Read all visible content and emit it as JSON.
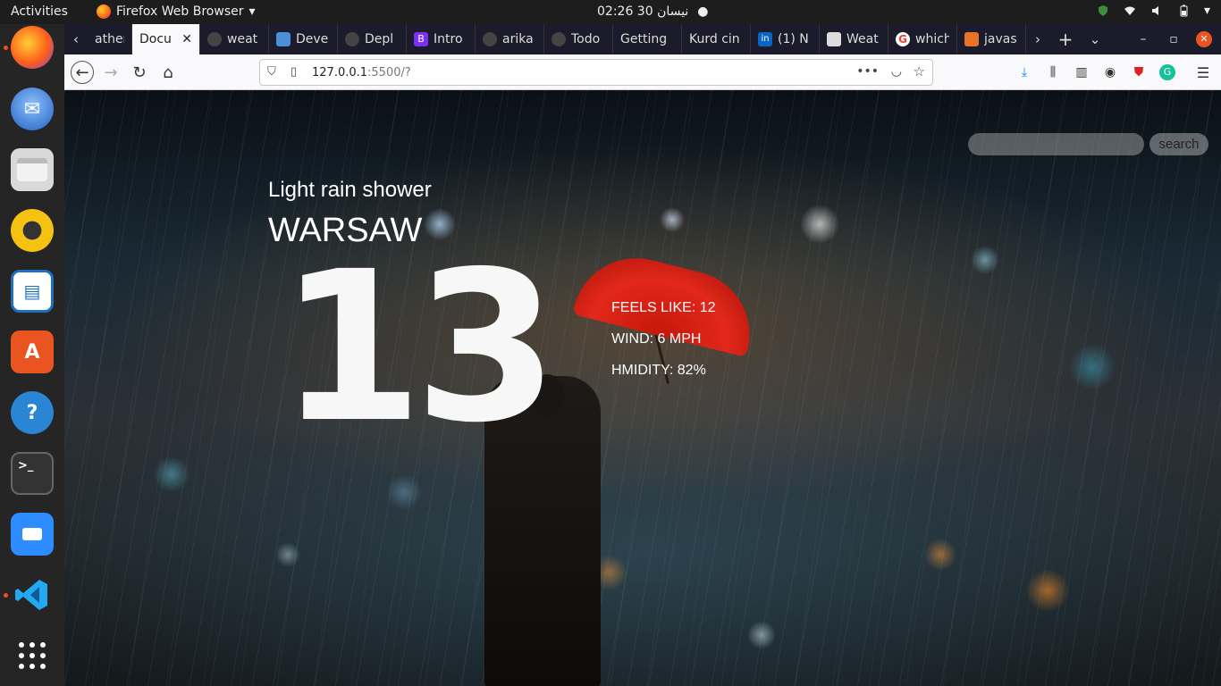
{
  "topbar": {
    "activities": "Activities",
    "app_name": "Firefox Web Browser",
    "clock": "02:26  30 نيسان"
  },
  "tabs": [
    {
      "label": "ather",
      "favicon_color": "#888888"
    },
    {
      "label": "Docu",
      "favicon_color": "",
      "active": true
    },
    {
      "label": "weat",
      "favicon_color": "#555555"
    },
    {
      "label": "Deve",
      "favicon_color": "#4a90d9"
    },
    {
      "label": "Depl",
      "favicon_color": "#555555"
    },
    {
      "label": "Intro",
      "favicon_color": "#7b2ff7"
    },
    {
      "label": "arika",
      "favicon_color": "#555555"
    },
    {
      "label": "Todo",
      "favicon_color": "#555555"
    },
    {
      "label": "Getting",
      "favicon_color": ""
    },
    {
      "label": "Kurd cin",
      "favicon_color": ""
    },
    {
      "label": "(1) N",
      "favicon_color": "#0a66c2"
    },
    {
      "label": "Weat",
      "favicon_color": "#dddddd"
    },
    {
      "label": "which",
      "favicon_color": "#ea4335"
    },
    {
      "label": "javas",
      "favicon_color": "#e8742a"
    }
  ],
  "navbar": {
    "url_host": "127.0.0.1",
    "url_path": ":5500/?"
  },
  "weather": {
    "search_placeholder": "",
    "search_button": "search",
    "condition": "Light rain shower",
    "city": "WARSAW",
    "temperature": "13",
    "feels_like": "FEELS LIKE: 12",
    "wind": "WIND: 6 MPH",
    "humidity": "HMIDITY: 82%"
  },
  "dock": [
    {
      "name": "firefox",
      "color": "#ff7139"
    },
    {
      "name": "thunderbird",
      "color": "#2a6db5"
    },
    {
      "name": "files",
      "color": "#d8d8d8"
    },
    {
      "name": "rhythmbox",
      "color": "#f5c211"
    },
    {
      "name": "libreoffice-impress",
      "color": "#1e6fc3"
    },
    {
      "name": "software",
      "color": "#e95420"
    },
    {
      "name": "help",
      "color": "#2a86d4"
    },
    {
      "name": "terminal",
      "color": "#333333"
    },
    {
      "name": "zoom",
      "color": "#2d8cff"
    },
    {
      "name": "vscode",
      "color": "#1f8ad2"
    },
    {
      "name": "app-grid",
      "color": "#ffffff"
    }
  ]
}
